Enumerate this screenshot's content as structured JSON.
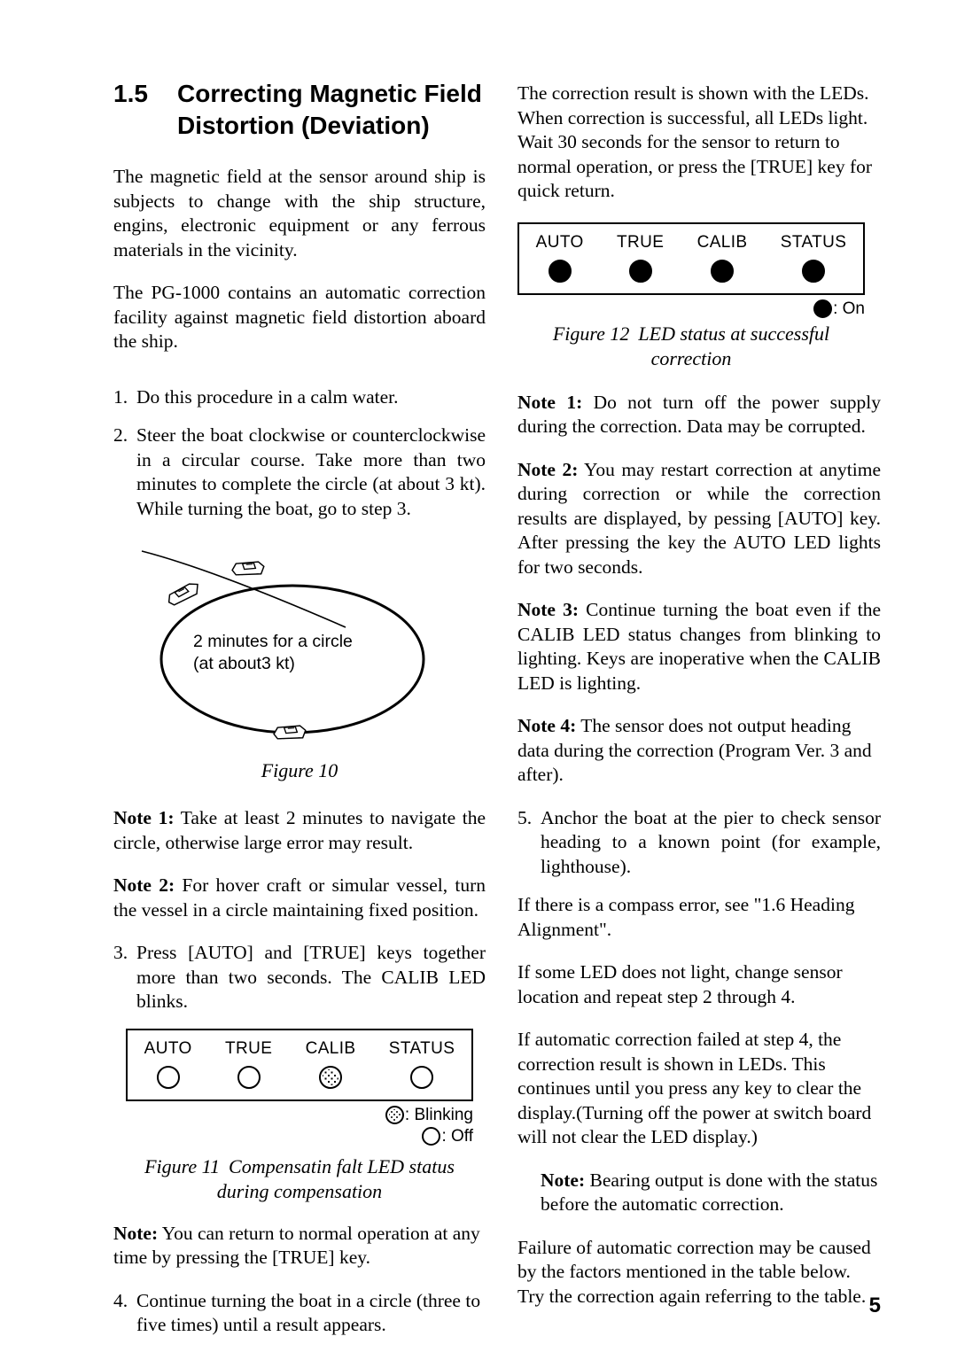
{
  "heading": {
    "number": "1.5",
    "title_line1": "Correcting Magnetic Field",
    "title_line2": "Distortion (Deviation)"
  },
  "left_column": {
    "intro_paragraph_1": "The magnetic field at the sensor around ship is subjects to change with the ship structure, engins, electronic equipment or any ferrous materials in the vicinity.",
    "intro_paragraph_2": "The PG-1000 contains an automatic correction facility against magnetic field distortion aboard the ship.",
    "step_1": {
      "number": "1.",
      "text": "Do this procedure in a calm water."
    },
    "step_2": {
      "number": "2.",
      "text": "Steer the boat clockwise or counterclockwise in a circular course. Take more than two minutes to complete the circle (at about 3 kt). While turning the boat, go to step 3."
    },
    "figure10": {
      "inner_label": "2 minutes for a circle\n(at about3 kt)",
      "caption": "Figure 10"
    },
    "note_1": {
      "label": "Note 1:",
      "text": " Take at least 2 minutes to navigate the circle,  otherwise large error may result."
    },
    "note_2": {
      "label": "Note 2:",
      "text": " For hover craft or simular vessel, turn the vessel in a circle maintaining fixed position."
    },
    "step_3": {
      "number": "3.",
      "text": "Press [AUTO] and [TRUE] keys together more than two seconds. The CALIB LED blinks."
    },
    "figure11": {
      "leds": [
        {
          "label": "AUTO",
          "state": "off"
        },
        {
          "label": "TRUE",
          "state": "off"
        },
        {
          "label": "CALIB",
          "state": "blink"
        },
        {
          "label": "STATUS",
          "state": "off"
        }
      ],
      "legend": [
        {
          "state": "blink",
          "text": ": Blinking"
        },
        {
          "state": "off",
          "text": ": Off"
        }
      ],
      "caption_word": "Figure 11",
      "caption_line1": "Compensatin falt LED status",
      "caption_line2": "during compensation"
    },
    "note_3": {
      "label": "Note:",
      "text": " You can return to normal operation at any time by pressing the [TRUE] key."
    },
    "step_4": {
      "number": "4.",
      "text": "Continue turning the boat in a circle (three to five times) until a result appears."
    }
  },
  "right_column": {
    "intro_paragraph": "The correction result is shown with the LEDs. When correction is successful, all LEDs light. Wait 30 seconds for the sensor to return to normal operation, or press the [TRUE] key for quick return.",
    "figure12": {
      "leds": [
        {
          "label": "AUTO",
          "state": "on"
        },
        {
          "label": "TRUE",
          "state": "on"
        },
        {
          "label": "CALIB",
          "state": "on"
        },
        {
          "label": "STATUS",
          "state": "on"
        }
      ],
      "legend": [
        {
          "state": "on",
          "text": ": On"
        }
      ],
      "caption_word": "Figure 12",
      "caption_line1": "LED status at successful",
      "caption_line2": "correction"
    },
    "note_1": {
      "label": "Note 1:",
      "text": " Do not turn off the power supply during the correction. Data may be corrupted."
    },
    "note_2": {
      "label": "Note 2:",
      "text": " You may restart correction at anytime during correction or while the correction results are displayed, by pessing [AUTO] key. After pressing the key the AUTO LED lights for two seconds."
    },
    "note_3": {
      "label": "Note 3:",
      "text": " Continue turning the boat even if the CALIB LED status changes from blinking to lighting. Keys are inoperative when the CALIB LED is lighting."
    },
    "note_4": {
      "label": "Note 4:",
      "text": " The sensor does not output heading data during the correction (Program Ver. 3 and after)."
    },
    "step_5": {
      "number": "5.",
      "text": "Anchor the boat at the pier to check sensor heading to a known point (for example, lighthouse)."
    },
    "para_compass_error": "If there is a compass error, see \"1.6 Heading Alignment\".",
    "para_led_not_light": "If some LED does not light, change sensor location and repeat step 2 through 4.",
    "para_failed_step4": "If automatic correction failed at step 4, the correction result is shown in LEDs. This continues until you press any key to clear the display.(Turning off the power at switch board will not clear the LED display.)",
    "note_bearing": {
      "label": "Note:",
      "text": " Bearing output is done with the status before the automatic correction."
    },
    "para_failure_table": "Failure of automatic correction may be caused by the factors mentioned in the table below. Try the correction again referring to the table."
  },
  "footer": {
    "page_number": "5"
  }
}
